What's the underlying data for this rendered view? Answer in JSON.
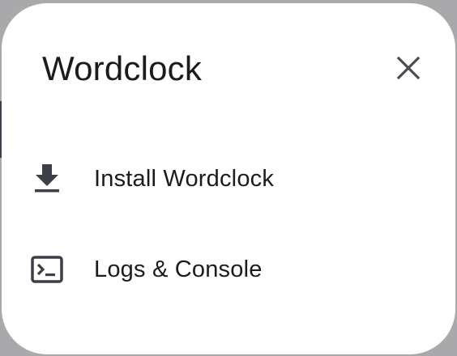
{
  "dialog": {
    "title": "Wordclock",
    "close_icon": "close-icon",
    "items": [
      {
        "label": "Install Wordclock",
        "icon": "download-icon"
      },
      {
        "label": "Logs & Console",
        "icon": "terminal-icon"
      }
    ]
  },
  "colors": {
    "backdrop": "#a9a9ab",
    "surface": "#ffffff",
    "text": "#1b1b1d",
    "icon": "#3c3f48"
  }
}
